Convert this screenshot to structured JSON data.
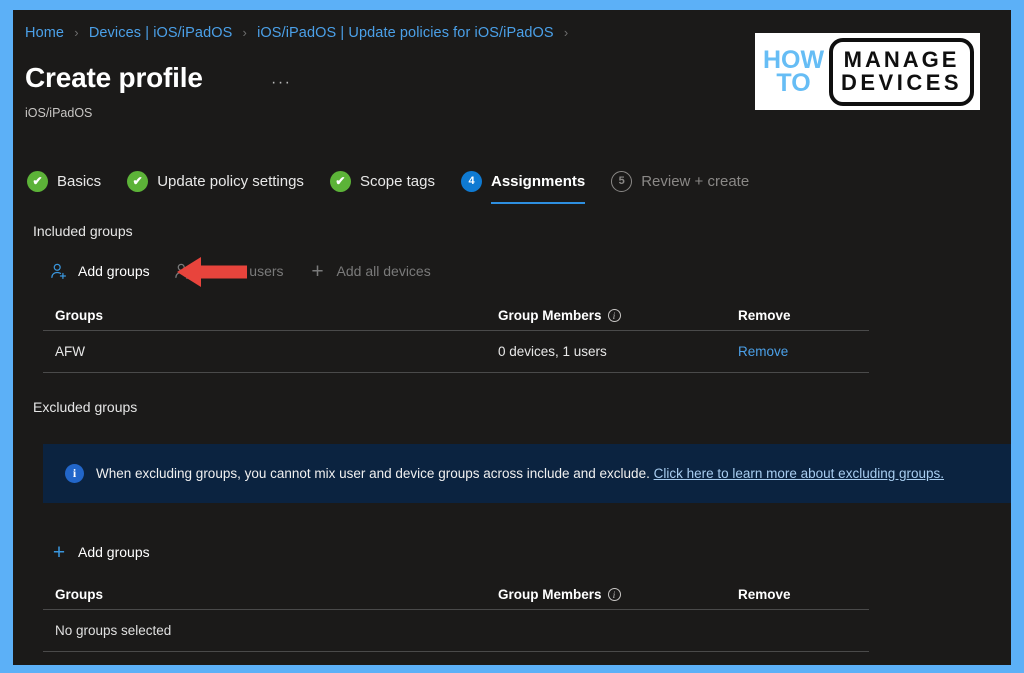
{
  "window": {
    "border_color": "#5cb0f7",
    "surface_color": "#1b1a19"
  },
  "breadcrumb": {
    "items": [
      "Home",
      "Devices | iOS/iPadOS",
      "iOS/iPadOS | Update policies for iOS/iPadOS"
    ],
    "separator": "›",
    "trailing_separator": "›"
  },
  "header": {
    "title": "Create profile",
    "ellipsis": "···",
    "subtitle": "iOS/iPadOS"
  },
  "logo": {
    "how": "HOW",
    "to": "TO",
    "manage": "MANAGE",
    "devices": "DEVICES",
    "accent_color": "#66bdf5"
  },
  "steps": [
    {
      "badge": "✔",
      "label": "Basics",
      "state": "done"
    },
    {
      "badge": "✔",
      "label": "Update policy settings",
      "state": "done"
    },
    {
      "badge": "✔",
      "label": "Scope tags",
      "state": "done"
    },
    {
      "badge": "4",
      "label": "Assignments",
      "state": "current"
    },
    {
      "badge": "5",
      "label": "Review + create",
      "state": "todo"
    }
  ],
  "included": {
    "section_label": "Included groups",
    "commands": [
      {
        "icon": "add-person-icon",
        "label": "Add groups",
        "enabled": true
      },
      {
        "icon": "add-users-icon",
        "label": "Add all users",
        "enabled": false
      },
      {
        "icon": "plus-icon",
        "label": "Add all devices",
        "enabled": false
      }
    ],
    "columns": [
      "Groups",
      "Group Members",
      "Remove"
    ],
    "rows": [
      {
        "group": "AFW",
        "members": "0 devices, 1 users",
        "remove": "Remove"
      }
    ]
  },
  "excluded": {
    "section_label": "Excluded groups",
    "banner": {
      "icon": "info-icon",
      "text": "When excluding groups, you cannot mix user and device groups across include and exclude.",
      "link": "Click here to learn more about excluding groups.",
      "background": "#0b2340"
    },
    "commands": [
      {
        "icon": "plus-icon",
        "label": "Add groups",
        "enabled": true
      }
    ],
    "columns": [
      "Groups",
      "Group Members",
      "Remove"
    ],
    "empty_text": "No groups selected"
  },
  "annotation": {
    "arrow": "red-left-arrow",
    "color": "#e8443c",
    "points_at": "Add groups"
  }
}
